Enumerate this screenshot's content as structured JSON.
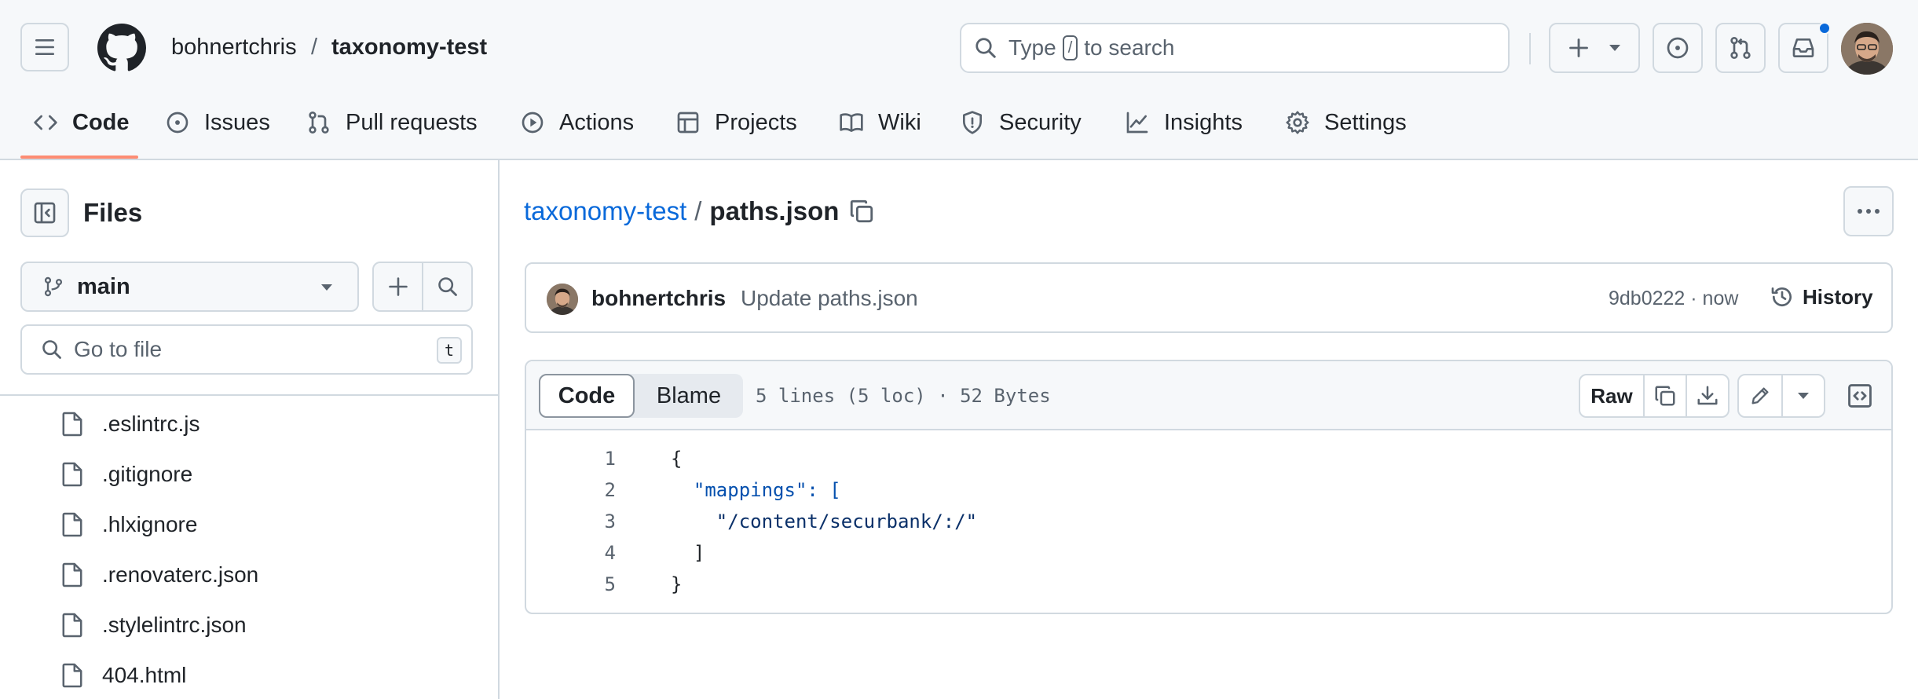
{
  "header": {
    "owner": "bohnertchris",
    "separator": "/",
    "repo": "taxonomy-test",
    "search": {
      "prefix": "Type",
      "key": "/",
      "suffix": "to search"
    }
  },
  "tabs": [
    {
      "label": "Code",
      "icon": "code-icon",
      "active": true
    },
    {
      "label": "Issues",
      "icon": "issue-opened-icon"
    },
    {
      "label": "Pull requests",
      "icon": "git-pull-request-icon"
    },
    {
      "label": "Actions",
      "icon": "play-icon"
    },
    {
      "label": "Projects",
      "icon": "table-icon"
    },
    {
      "label": "Wiki",
      "icon": "book-icon"
    },
    {
      "label": "Security",
      "icon": "shield-icon"
    },
    {
      "label": "Insights",
      "icon": "graph-icon"
    },
    {
      "label": "Settings",
      "icon": "gear-icon"
    }
  ],
  "sidebar": {
    "title": "Files",
    "branch": "main",
    "goto_placeholder": "Go to file",
    "goto_shortcut": "t",
    "files": [
      ".eslintrc.js",
      ".gitignore",
      ".hlxignore",
      ".renovaterc.json",
      ".stylelintrc.json",
      "404.html"
    ]
  },
  "breadcrumb": {
    "repo": "taxonomy-test",
    "separator": "/",
    "file": "paths.json"
  },
  "commit": {
    "author": "bohnertchris",
    "message": "Update paths.json",
    "hash_time": "9db0222 · now",
    "history_label": "History"
  },
  "code_view": {
    "tab_code": "Code",
    "tab_blame": "Blame",
    "meta": "5 lines (5 loc) · 52 Bytes",
    "raw_label": "Raw",
    "lines": [
      {
        "n": "1",
        "text": "{"
      },
      {
        "n": "2",
        "text": "  \"mappings\": ["
      },
      {
        "n": "3",
        "text": "    \"/content/securbank/:/\""
      },
      {
        "n": "4",
        "text": "  ]"
      },
      {
        "n": "5",
        "text": "}"
      }
    ]
  },
  "colors": {
    "accent": "#0969da",
    "tab_underline": "#fd8c73",
    "border": "#d1d9e0",
    "header_bg": "#f6f8fa"
  }
}
